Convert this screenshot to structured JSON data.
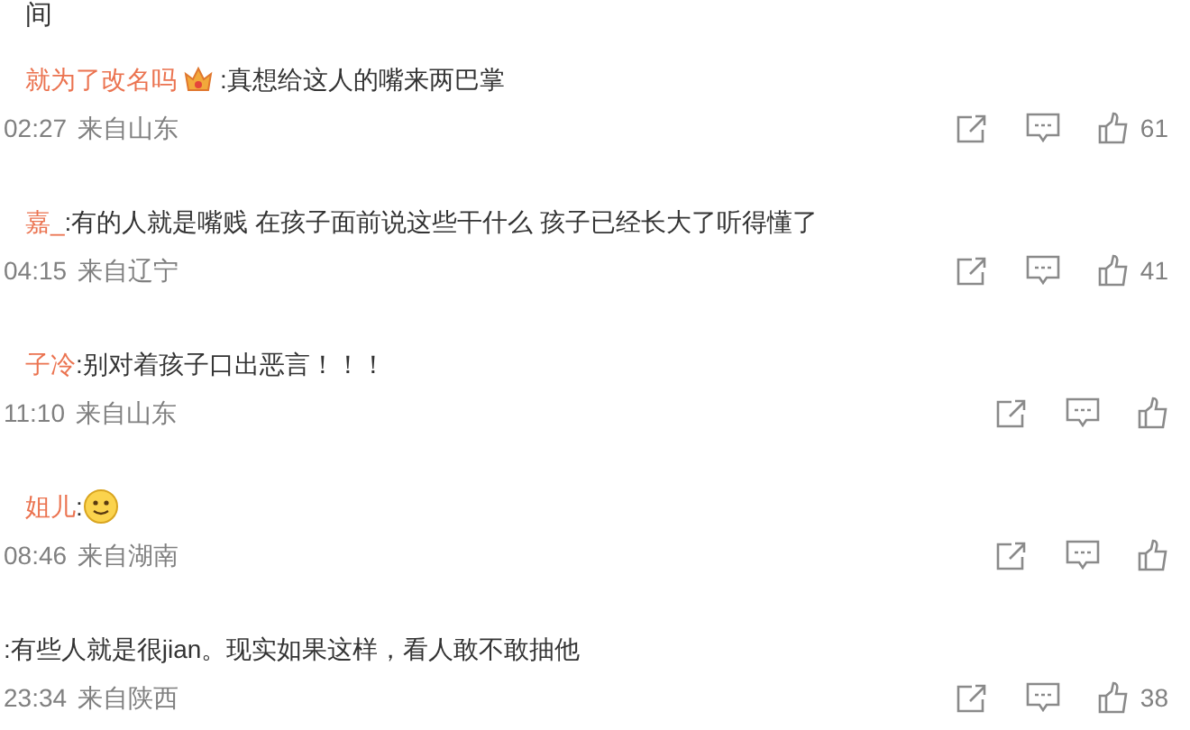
{
  "header": "间",
  "comments": [
    {
      "name": "就为了改名吗",
      "badge": true,
      "kind": "text",
      "content": ":真想给这人的嘴来两巴掌",
      "time": "02:27",
      "location": "来自山东",
      "likes": "61"
    },
    {
      "name": "嘉_",
      "badge": false,
      "kind": "text",
      "content": ":有的人就是嘴贱 在孩子面前说这些干什么 孩子已经长大了听得懂了",
      "time": "04:15",
      "location": "来自辽宁",
      "likes": "41"
    },
    {
      "name": "子冷",
      "badge": false,
      "kind": "text",
      "content": ":别对着孩子口出恶言！！！",
      "time": "11:10",
      "location": "来自山东"
    },
    {
      "name": "姐儿",
      "badge": false,
      "kind": "emoji",
      "content": ":",
      "time": "08:46",
      "location": "来自湖南"
    },
    {
      "badge": false,
      "kind": "text",
      "content": ":有些人就是很jian。现实如果这样，看人敢不敢抽他",
      "time": "23:34",
      "location": "来自陕西",
      "likes": "38"
    }
  ]
}
